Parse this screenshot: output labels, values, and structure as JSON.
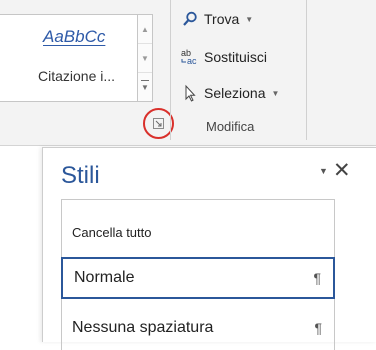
{
  "ribbon": {
    "gallery": {
      "sample_text": "AaBbCc",
      "style_label": "Citazione i...",
      "more_button": "more-styles"
    },
    "editing_group": {
      "find_label": "Trova",
      "replace_label": "Sostituisci",
      "select_label": "Seleziona",
      "group_label": "Modifica",
      "replace_icon_top": "ab",
      "replace_icon_bottom": "ac"
    },
    "launcher_highlight_color": "#d9302b"
  },
  "styles_pane": {
    "title": "Stili",
    "items": [
      {
        "label": "Cancella tutto",
        "mark": ""
      },
      {
        "label": "Normale",
        "mark": "¶"
      },
      {
        "label": "Nessuna spaziatura",
        "mark": "¶"
      }
    ],
    "accent_color": "#2b579a"
  }
}
